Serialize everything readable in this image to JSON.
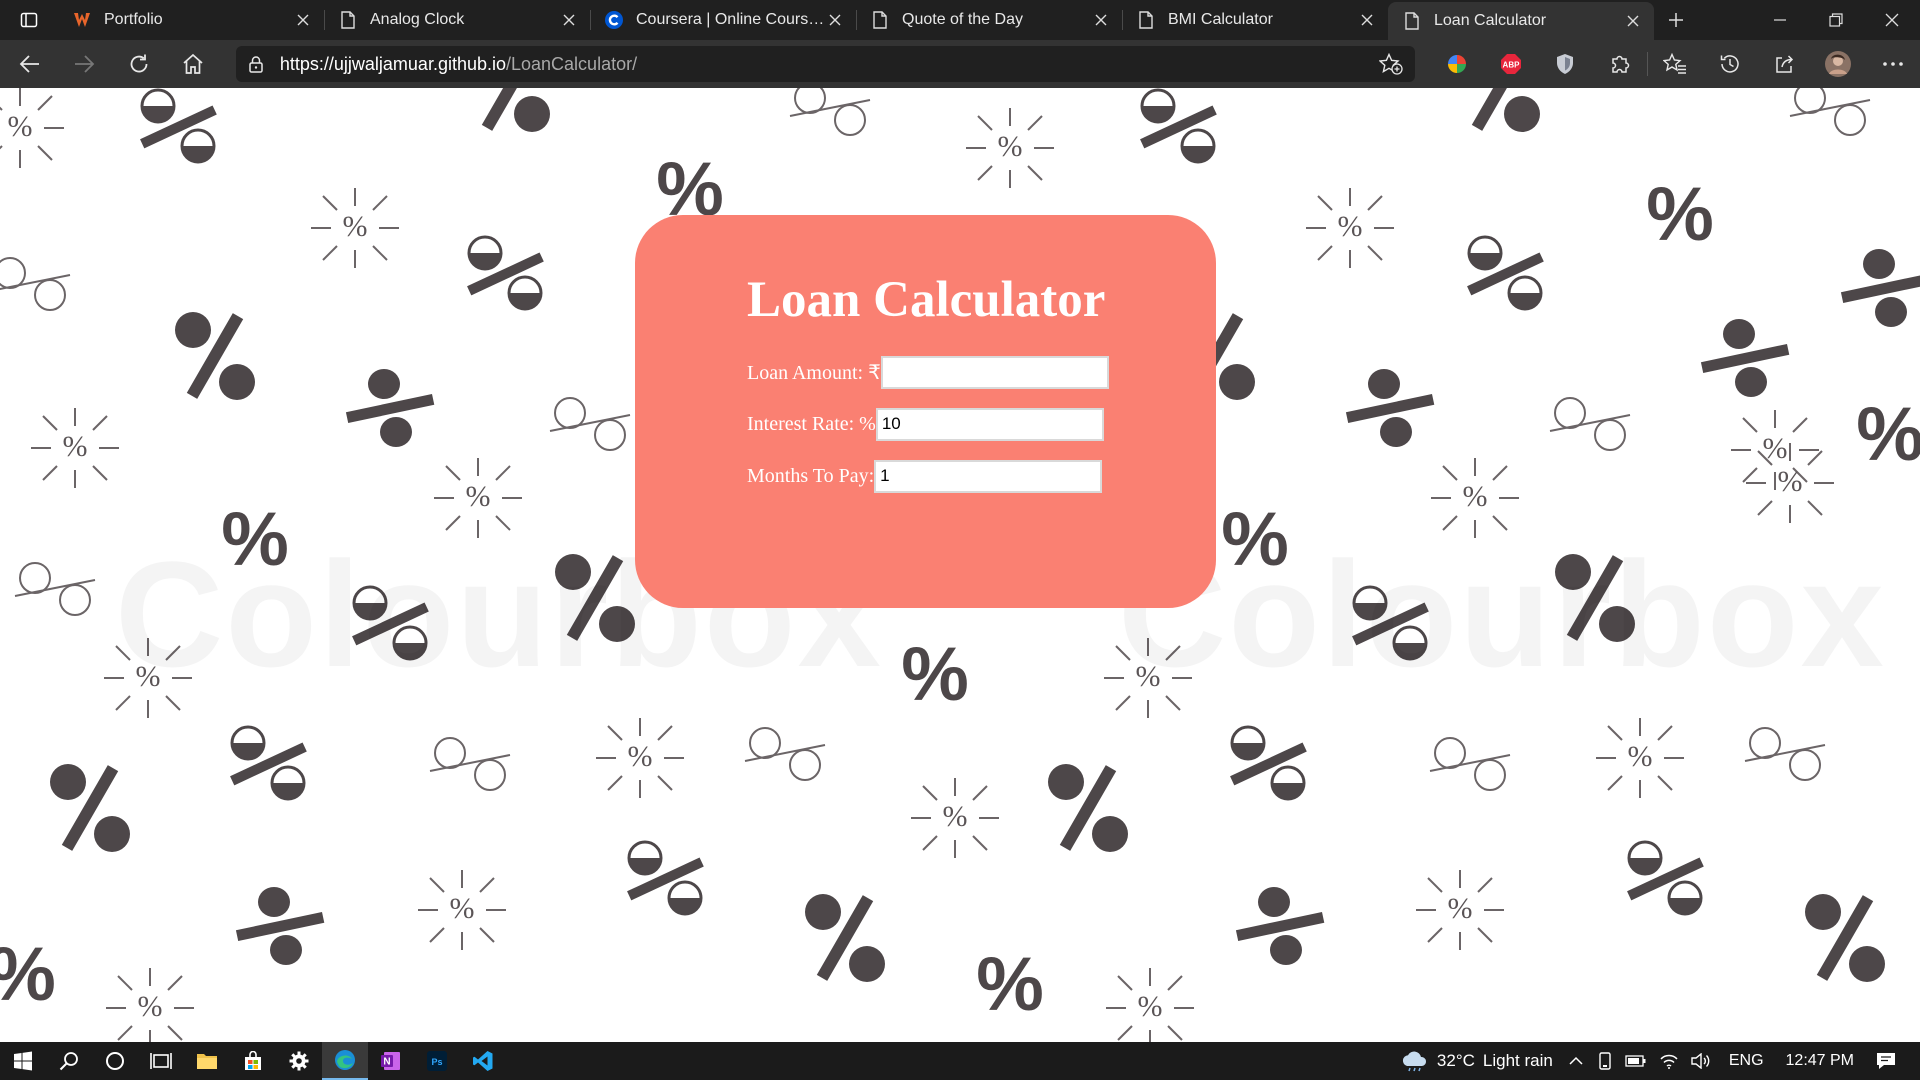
{
  "browser": {
    "tabs": [
      {
        "title": "Portfolio",
        "icon": "portfolio-favicon"
      },
      {
        "title": "Analog Clock",
        "icon": "page-icon"
      },
      {
        "title": "Coursera | Online Courses & Credentials From Top Educators",
        "icon": "coursera-favicon"
      },
      {
        "title": "Quote of the Day",
        "icon": "page-icon"
      },
      {
        "title": "BMI Calculator",
        "icon": "page-icon"
      },
      {
        "title": "Loan Calculator",
        "icon": "page-icon",
        "active": true
      }
    ],
    "url_host": "https://ujjwaljamuar.github.io",
    "url_path": "/LoanCalculator/"
  },
  "page": {
    "watermark": "Colourbox",
    "title": "Loan Calculator",
    "fields": {
      "loan_amount": {
        "label": "Loan Amount: ₹",
        "value": ""
      },
      "interest_rate": {
        "label": "Interest Rate: %",
        "value": "10"
      },
      "months": {
        "label": "Months To Pay:",
        "value": "1"
      }
    }
  },
  "taskbar": {
    "weather": "32°C",
    "weather_desc": "Light rain",
    "language": "ENG",
    "time": "12:47 PM"
  },
  "colors": {
    "card": "#fa8072",
    "chrome_dark": "#202020",
    "chrome_toolbar": "#333333"
  }
}
